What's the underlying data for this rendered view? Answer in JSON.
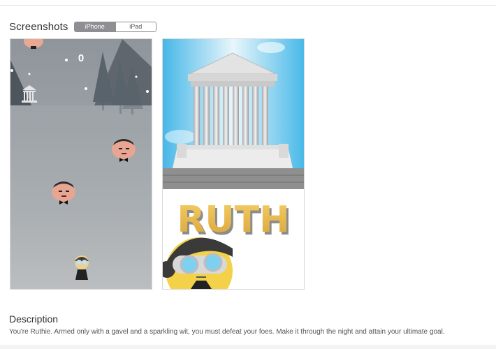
{
  "screenshots": {
    "title": "Screenshots",
    "tabs": [
      {
        "label": "iPhone",
        "active": true
      },
      {
        "label": "iPad",
        "active": false
      }
    ],
    "images": [
      {
        "name": "gameplay-screenshot",
        "score_text": "0"
      },
      {
        "name": "title-screenshot",
        "logo_text": "RUTH"
      }
    ]
  },
  "description": {
    "title": "Description",
    "text": "You're Ruthie. Armed only with a gavel and a sparkling wit, you must defeat your foes. Make it through the night and attain your ultimate goal."
  },
  "colors": {
    "segment_active": "#8e8e93",
    "logo_gold": "#e8b945"
  }
}
